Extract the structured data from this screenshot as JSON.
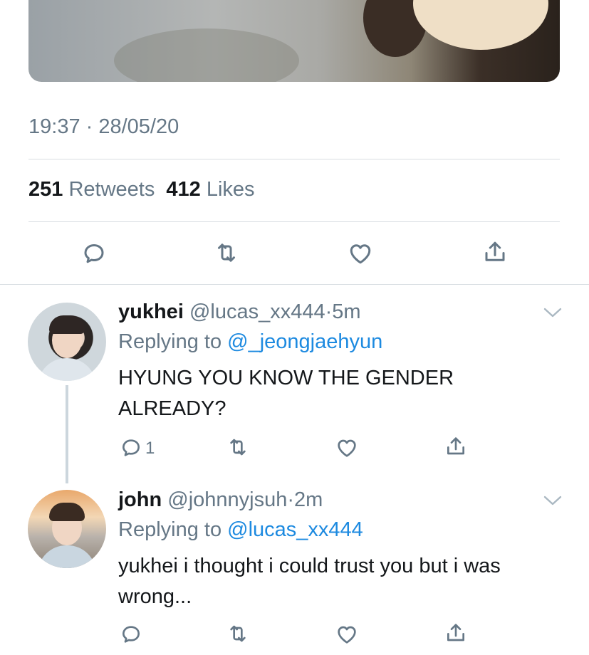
{
  "tweet": {
    "timestamp": "19:37 · 28/05/20",
    "retweets_count": "251",
    "retweets_label": "Retweets",
    "likes_count": "412",
    "likes_label": "Likes"
  },
  "icons": {
    "reply": "reply-icon",
    "retweet": "retweet-icon",
    "like": "heart-icon",
    "share": "share-icon",
    "caret": "chevron-down-icon"
  },
  "replies": [
    {
      "name": "yukhei",
      "handle": "@lucas_xx444",
      "dot": "·",
      "time": "5m",
      "replying_prefix": "Replying to",
      "replying_to": "@_jeongjaehyun",
      "text": "HYUNG YOU KNOW THE GENDER ALREADY?",
      "reply_count": "1"
    },
    {
      "name": "john",
      "handle": "@johnnyjsuh",
      "dot": "·",
      "time": "2m",
      "replying_prefix": "Replying to",
      "replying_to": "@lucas_xx444",
      "text": "yukhei i thought i could trust you but i was wrong...",
      "reply_count": ""
    }
  ],
  "colors": {
    "text_primary": "#14171a",
    "text_secondary": "#657786",
    "link": "#1d8ae0",
    "divider": "#d8dde2"
  }
}
